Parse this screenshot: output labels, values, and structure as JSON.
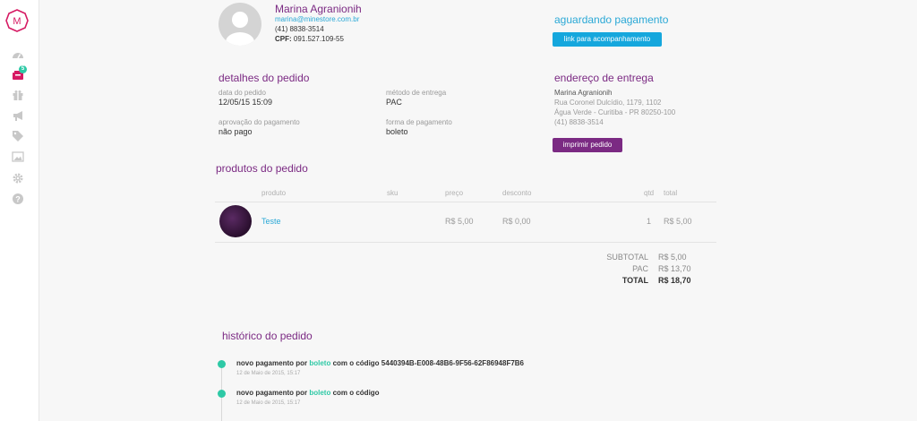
{
  "sidebar": {
    "logo_letter": "M",
    "badge_count": "5",
    "icons": [
      "dashboard-icon",
      "orders-icon",
      "gift-icon",
      "megaphone-icon",
      "tag-icon",
      "image-icon",
      "gear-icon",
      "help-icon"
    ]
  },
  "customer": {
    "name": "Marina Agranionih",
    "email": "marina@minestore.com.br",
    "phone": "(41) 8838-3514",
    "cpf_label": "CPF:",
    "cpf": "091.527.109-55"
  },
  "status": {
    "text": "aguardando pagamento",
    "link_button": "link para acompanhamento"
  },
  "details": {
    "title": "detalhes do pedido",
    "order_date_label": "data do pedido",
    "order_date": "12/05/15 15:09",
    "delivery_method_label": "método de entrega",
    "delivery_method": "PAC",
    "payment_approval_label": "aprovação do pagamento",
    "payment_approval": "não pago",
    "payment_method_label": "forma de pagamento",
    "payment_method": "boleto"
  },
  "address": {
    "title": "endereço de entrega",
    "name": "Marina Agranionih",
    "street": "Rua Coronel Dulcídio, 1179, 1102",
    "city": "Água Verde - Curitiba - PR 80250-100",
    "phone": "(41) 8838-3514",
    "print_button": "imprimir pedido"
  },
  "products": {
    "title": "produtos do pedido",
    "headers": {
      "produto": "produto",
      "sku": "sku",
      "preco": "preço",
      "desconto": "desconto",
      "qtd": "qtd",
      "total": "total"
    },
    "rows": [
      {
        "name": "Teste",
        "sku": "",
        "price": "R$ 5,00",
        "discount": "R$ 0,00",
        "qty": "1",
        "total": "R$ 5,00"
      }
    ]
  },
  "totals": {
    "subtotal_label": "SUBTOTAL",
    "subtotal": "R$ 5,00",
    "shipping_label": "PAC",
    "shipping": "R$ 13,70",
    "total_label": "TOTAL",
    "total": "R$ 18,70"
  },
  "history": {
    "title": "histórico do pedido",
    "entries": [
      {
        "prefix": "novo pagamento por ",
        "method": "boleto",
        "suffix": " com o código 5440394B-E008-48B6-9F56-62F86948F7B6",
        "date": "12 de Maio de 2015, 15:17"
      },
      {
        "prefix": "novo pagamento por ",
        "method": "boleto",
        "suffix": " com o código",
        "date": "12 de Maio de 2015, 15:17"
      }
    ]
  },
  "colors": {
    "accent_purple": "#7b2a83",
    "accent_blue": "#15a7dd",
    "accent_green": "#2ec9a6"
  }
}
